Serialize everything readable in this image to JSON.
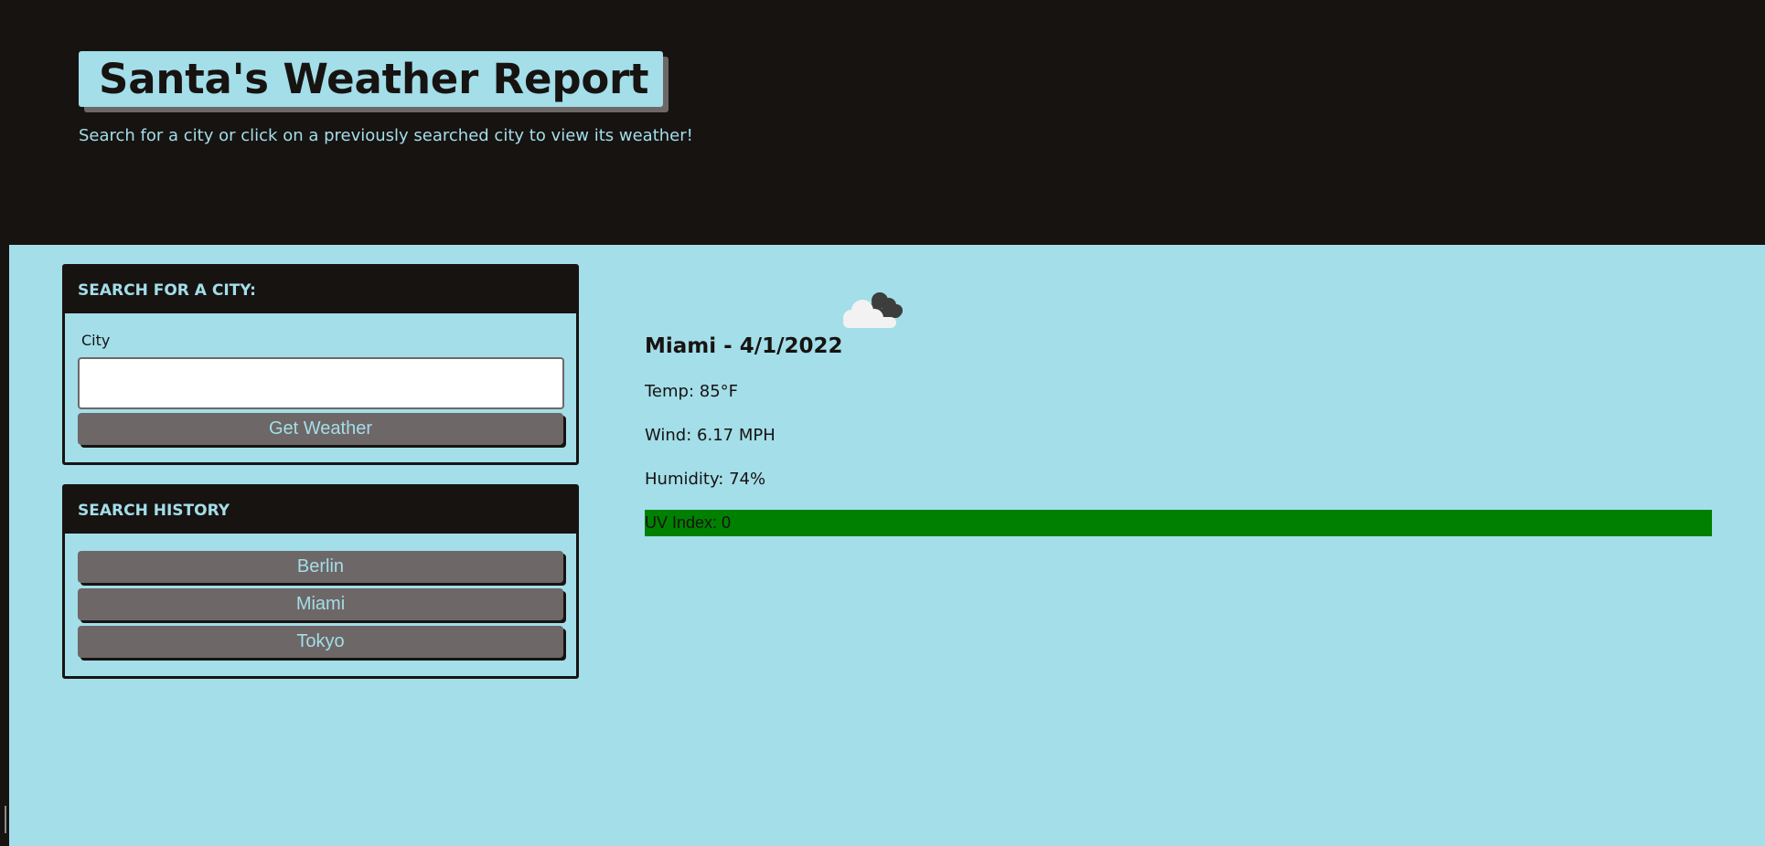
{
  "header": {
    "title": "Santa's Weather Report",
    "subtitle": "Search for a city or click on a previously searched city to view its weather!"
  },
  "search": {
    "heading": "SEARCH FOR A CITY:",
    "city_label": "City",
    "city_value": "",
    "button_label": "Get Weather"
  },
  "history": {
    "heading": "SEARCH HISTORY",
    "cities": [
      "Berlin",
      "Miami",
      "Tokyo"
    ]
  },
  "current": {
    "icon": "cloudy-icon",
    "city_date": "Miami - 4/1/2022",
    "temp": "Temp: 85°F",
    "wind": "Wind: 6.17 MPH",
    "humidity": "Humidity: 74%",
    "uv": "UV Index: 0",
    "uv_color": "#008000"
  },
  "colors": {
    "background": "#a3dee9",
    "dark": "#171311",
    "button": "#6e6767"
  }
}
